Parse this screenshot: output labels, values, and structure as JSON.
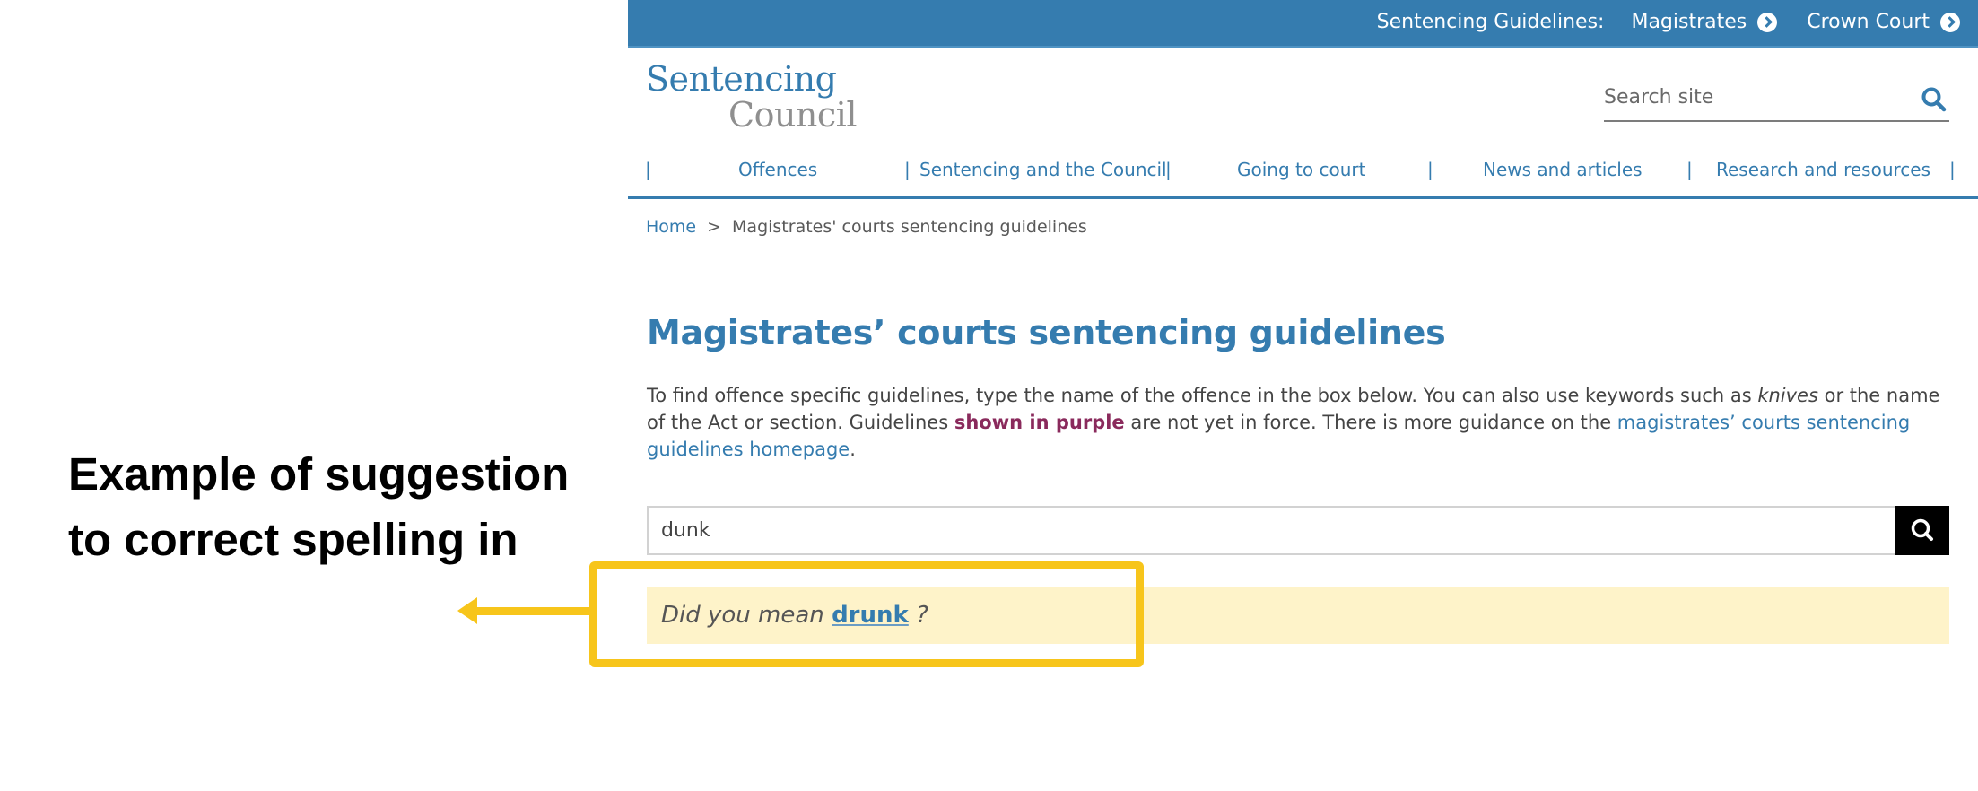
{
  "annotation": {
    "text": "Example of suggestion to correct spelling in",
    "highlight_color": "#f7c51b"
  },
  "topbar": {
    "label": "Sentencing Guidelines:",
    "links": [
      {
        "label": "Magistrates",
        "icon": "chevron-circle-right-icon"
      },
      {
        "label": "Crown Court",
        "icon": "chevron-circle-right-icon"
      }
    ],
    "background": "#357caf"
  },
  "logo": {
    "line1": "Sentencing",
    "line2": "Council"
  },
  "site_search": {
    "placeholder": "Search site",
    "icon": "search-icon"
  },
  "nav": {
    "separator": "|",
    "items": [
      {
        "label": "Offences"
      },
      {
        "label": "Sentencing and the Council"
      },
      {
        "label": "Going to court"
      },
      {
        "label": "News and articles"
      },
      {
        "label": "Research and resources"
      }
    ]
  },
  "breadcrumb": {
    "home": "Home",
    "separator": ">",
    "current": "Magistrates' courts sentencing guidelines"
  },
  "main": {
    "title": "Magistrates’ courts sentencing guidelines",
    "intro": {
      "part1": "To find offence specific guidelines, type the name of the offence in the box below. You can also use keywords such as ",
      "italic": "knives",
      "part2": " or the name of the Act or section. Guidelines ",
      "purple": "shown in purple",
      "part3": " are not yet in force. There is more guidance on the ",
      "link": "magistrates’ courts sentencing guidelines homepage",
      "part4": "."
    },
    "search": {
      "value": "dunk",
      "button_icon": "search-icon"
    },
    "suggestion": {
      "prefix": "Did you mean ",
      "word": "drunk",
      "suffix": " ?"
    }
  },
  "colors": {
    "brand_blue": "#357caf",
    "purple": "#8a2a5c",
    "suggestion_bg": "#fef3c9"
  }
}
